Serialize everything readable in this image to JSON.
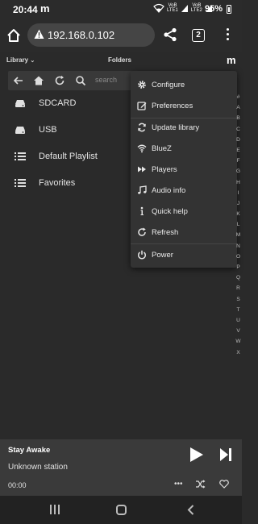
{
  "status_bar": {
    "time": "20:44",
    "carrier_logo": "m",
    "net1": "VoB\nLTE1",
    "net2": "VoB\nLTE2",
    "battery": "95%"
  },
  "browser": {
    "url": "192.168.0.102",
    "tab_count": "2"
  },
  "app_header": {
    "library_label": "Library",
    "title": "Folders",
    "logo": "m"
  },
  "nav": {
    "search_placeholder": "search"
  },
  "library_items": [
    {
      "label": "SDCARD",
      "icon": "drive-icon"
    },
    {
      "label": "USB",
      "icon": "drive-icon"
    },
    {
      "label": "Default Playlist",
      "icon": "list-icon"
    },
    {
      "label": "Favorites",
      "icon": "list-icon"
    }
  ],
  "menu": {
    "items": [
      {
        "label": "Configure",
        "icon": "gear-icon"
      },
      {
        "label": "Preferences",
        "icon": "edit-icon"
      },
      {
        "label": "Update library",
        "icon": "sync-icon"
      },
      {
        "label": "BlueZ",
        "icon": "wifi-icon"
      },
      {
        "label": "Players",
        "icon": "fast-forward-icon"
      },
      {
        "label": "Audio info",
        "icon": "music-note-icon"
      },
      {
        "label": "Quick help",
        "icon": "info-icon"
      },
      {
        "label": "Refresh",
        "icon": "refresh-icon"
      },
      {
        "label": "Power",
        "icon": "power-icon"
      }
    ]
  },
  "alpha_index": [
    "#",
    "A",
    "B",
    "C",
    "D",
    "E",
    "F",
    "G",
    "H",
    "I",
    "J",
    "K",
    "L",
    "M",
    "N",
    "O",
    "P",
    "Q",
    "R",
    "S",
    "T",
    "U",
    "V",
    "W",
    "X"
  ],
  "player": {
    "title": "Stay Awake",
    "station": "Unknown station",
    "elapsed": "00:00",
    "more": "•••"
  },
  "colors": {
    "background": "#2a2a2a",
    "menu_background": "#333333",
    "player_background": "#3a3a3a"
  }
}
